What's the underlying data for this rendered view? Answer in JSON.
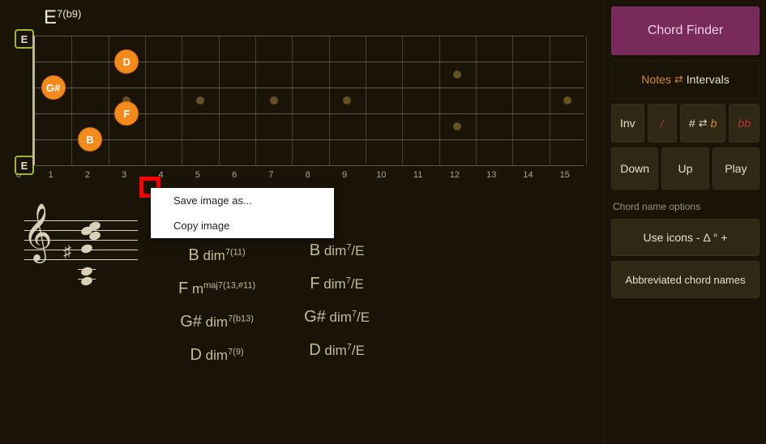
{
  "chord_title": {
    "root": "E",
    "quality": "7(b9)"
  },
  "open_strings": {
    "top": "E",
    "bottom": "E"
  },
  "fretboard": {
    "strings": 6,
    "frets": 15,
    "markers_single": [
      3,
      5,
      7,
      9,
      15
    ],
    "markers_double": [
      12
    ],
    "notes": [
      {
        "label": "D",
        "string": 1,
        "fret": 3
      },
      {
        "label": "G#",
        "string": 2,
        "fret": 1
      },
      {
        "label": "F",
        "string": 3,
        "fret": 3
      },
      {
        "label": "B",
        "string": 4,
        "fret": 2
      }
    ],
    "fret_numbers": [
      "0",
      "1",
      "2",
      "3",
      "4",
      "5",
      "6",
      "7",
      "8",
      "9",
      "10",
      "11",
      "12",
      "13",
      "14",
      "15"
    ]
  },
  "primary_chord": {
    "root": "E",
    "sup": "7(b9)"
  },
  "chord_list_left": [
    {
      "root": "B",
      "suf": " dim",
      "sup": "7(11)"
    },
    {
      "root": "F",
      "suf": " m",
      "sup": "maj7(13,#11)"
    },
    {
      "root": "G#",
      "suf": " dim",
      "sup": "7(b13)"
    },
    {
      "root": "D",
      "suf": " dim",
      "sup": "7(9)"
    }
  ],
  "chord_list_right": [
    {
      "root": "B",
      "suf": " dim",
      "sup": "7",
      "slash": "/E"
    },
    {
      "root": "F",
      "suf": " dim",
      "sup": "7",
      "slash": "/E"
    },
    {
      "root": "G#",
      "suf": " dim",
      "sup": "7",
      "slash": "/E"
    },
    {
      "root": "D",
      "suf": " dim",
      "sup": "7",
      "slash": "/E"
    }
  ],
  "right_panel": {
    "chord_finder": "Chord Finder",
    "notes_intervals": {
      "left": "Notes",
      "right": "Intervals"
    },
    "inv": "Inv",
    "slash": "/",
    "sharp_flat": {
      "sharp": "#",
      "flat": "b"
    },
    "bb": "bb",
    "down": "Down",
    "up": "Up",
    "play": "Play",
    "options_label": "Chord name options",
    "use_icons": "Use icons - Δ ° +",
    "abbrev": "Abbreviated chord names"
  },
  "context_menu": {
    "save_as": "Save image as...",
    "copy_image": "Copy image"
  }
}
